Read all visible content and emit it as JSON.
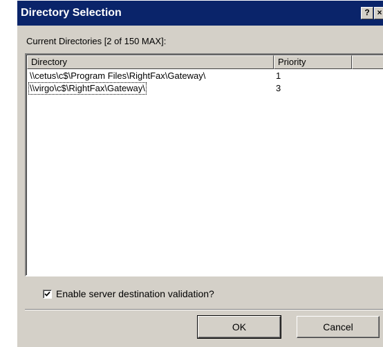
{
  "window": {
    "title": "Directory Selection",
    "help_label": "?",
    "close_label": "×",
    "title_bar_color": "#0a246a",
    "face_color": "#d4d0c8"
  },
  "caption": "Current Directories [2 of 150 MAX]:",
  "list": {
    "columns": [
      "Directory",
      "Priority"
    ],
    "rows": [
      {
        "directory": "\\\\cetus\\c$\\Program Files\\RightFax\\Gateway\\",
        "priority": "1"
      },
      {
        "directory": "\\\\virgo\\c$\\RightFax\\Gateway\\",
        "priority": "3"
      }
    ]
  },
  "options": {
    "validate_label": "Enable server destination validation?",
    "validate_checked": true
  },
  "buttons": {
    "ok_label": "OK",
    "cancel_label": "Cancel"
  }
}
